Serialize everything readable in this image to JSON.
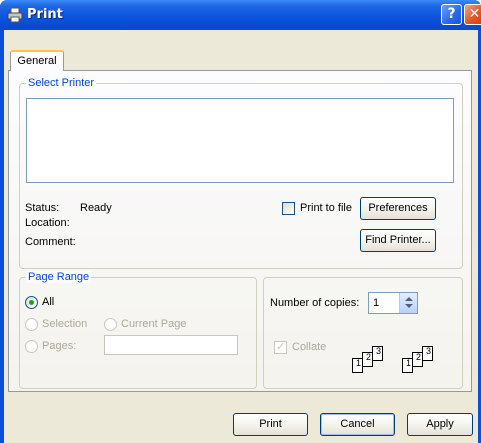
{
  "window": {
    "title": "Print",
    "help_glyph": "?",
    "close_glyph": "✕"
  },
  "tabs": [
    {
      "label": "General"
    }
  ],
  "select_printer": {
    "group_label": "Select Printer",
    "status_label": "Status:",
    "status_value": "Ready",
    "location_label": "Location:",
    "comment_label": "Comment:",
    "print_to_file_label": "Print to file",
    "print_to_file_accel": "f",
    "preferences_label": "Preferences",
    "find_printer_label": "Find Printer..."
  },
  "page_range": {
    "group_label": "Page Range",
    "all_label": "All",
    "selection_label": "Selection",
    "current_page_label": "Current Page",
    "pages_label": "Pages:",
    "pages_value": "",
    "selected": "all"
  },
  "copies": {
    "number_of_copies_label": "Number of copies:",
    "value": "1",
    "collate_label": "Collate",
    "collate_checked": true,
    "collate_disabled": true,
    "page_numbers": [
      "1",
      "2",
      "3"
    ]
  },
  "footer": {
    "print_label": "Print",
    "cancel_label": "Cancel",
    "apply_label": "Apply"
  },
  "colors": {
    "titlebar": "#0c55de",
    "group_label": "#0046d5",
    "dialog_bg": "#ece9d8"
  }
}
